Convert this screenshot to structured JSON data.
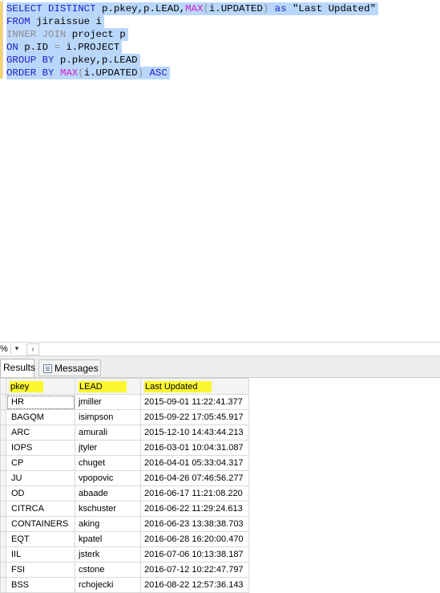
{
  "editor": {
    "lines": [
      [
        {
          "t": "SELECT DISTINCT",
          "c": "kw"
        },
        {
          "t": " p.pkey,p.LEAD,",
          "c": ""
        },
        {
          "t": "MAX",
          "c": "fn"
        },
        {
          "t": "(",
          "c": "gr"
        },
        {
          "t": "i.UPDATED",
          "c": ""
        },
        {
          "t": ")",
          "c": "gr"
        },
        {
          "t": " ",
          "c": ""
        },
        {
          "t": "as",
          "c": "kw"
        },
        {
          "t": " ",
          "c": ""
        },
        {
          "t": "\"Last Updated\"",
          "c": ""
        }
      ],
      [
        {
          "t": "FROM",
          "c": "kw"
        },
        {
          "t": " jiraissue i",
          "c": ""
        }
      ],
      [
        {
          "t": "INNER JOIN",
          "c": "gr"
        },
        {
          "t": " project p",
          "c": ""
        }
      ],
      [
        {
          "t": "ON",
          "c": "kw"
        },
        {
          "t": " p.ID ",
          "c": ""
        },
        {
          "t": "=",
          "c": "gr"
        },
        {
          "t": " i.PROJECT",
          "c": ""
        }
      ],
      [
        {
          "t": "GROUP BY",
          "c": "kw"
        },
        {
          "t": " p.pkey,p.LEAD",
          "c": ""
        }
      ],
      [
        {
          "t": "ORDER BY",
          "c": "kw"
        },
        {
          "t": " ",
          "c": ""
        },
        {
          "t": "MAX",
          "c": "fn"
        },
        {
          "t": "(",
          "c": "gr"
        },
        {
          "t": "i.UPDATED",
          "c": ""
        },
        {
          "t": ")",
          "c": "gr"
        },
        {
          "t": " ",
          "c": ""
        },
        {
          "t": "ASC",
          "c": "kw"
        }
      ]
    ]
  },
  "strip": {
    "zoom_label": "%",
    "zoom_dropdown_icon": "chevron-down-icon",
    "scroll_left_icon": "chevron-left-icon"
  },
  "tabs": {
    "results_label": "Results",
    "messages_label": "Messages",
    "messages_icon": "messages-icon"
  },
  "grid": {
    "columns": [
      "pkey",
      "LEAD",
      "Last Updated"
    ],
    "rows": [
      [
        "HR",
        "jmiller",
        "2015-09-01 11:22:41.377"
      ],
      [
        "BAGQM",
        "isimpson",
        "2015-09-22 17:05:45.917"
      ],
      [
        "ARC",
        "amurali",
        "2015-12-10 14:43:44.213"
      ],
      [
        "IOPS",
        "jtyler",
        "2016-03-01 10:04:31.087"
      ],
      [
        "CP",
        "chuget",
        "2016-04-01 05:33:04.317"
      ],
      [
        "JU",
        "vpopovic",
        "2016-04-26 07:46:56.277"
      ],
      [
        "OD",
        "abaade",
        "2016-06-17 11:21:08.220"
      ],
      [
        "CITRCA",
        "kschuster",
        "2016-06-22 11:29:24.613"
      ],
      [
        "CONTAINERS",
        "aking",
        "2016-06-23 13:38:38.703"
      ],
      [
        "EQT",
        "kpatel",
        "2016-06-28 16:20:00.470"
      ],
      [
        "IIL",
        "jsterk",
        "2016-07-06 10:13:38.187"
      ],
      [
        "FSI",
        "cstone",
        "2016-07-12 10:22:47.797"
      ],
      [
        "BSS",
        "rchojecki",
        "2016-08-22 12:57:36.143"
      ]
    ]
  },
  "colors": {
    "selection": "#b9d7fb",
    "keyword": "#1d1dc9",
    "function": "#d31ec7",
    "highlight": "#fdf731"
  }
}
